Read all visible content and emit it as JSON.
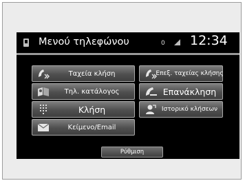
{
  "header": {
    "title": "Μενού τηλεφώνου",
    "status_text": "0",
    "clock": "12:34"
  },
  "menu": {
    "speed_dial": "Ταχεία κλήση",
    "edit_speed_dial": "Επεξ. ταχείας κλήσης",
    "phonebook": "Τηλ. κατάλογος",
    "redial": "Επανάκληση",
    "dial": "Κλήση",
    "call_history": "Ιστορικό κλήσεων",
    "text_email": "Κείμενο/Email"
  },
  "footer": {
    "settings_label": "Ρύθμιση"
  },
  "icons": {
    "speed_dial": "handset-arrows-icon",
    "edit_speed_dial": "handset-arrows-icon",
    "phonebook": "book-icon",
    "redial": "handset-icon",
    "dial": "keypad-icon",
    "call_history": "caller-icon",
    "text_email": "envelope-icon"
  },
  "colors": {
    "screen_background": "#000000",
    "tile_top": "#7d7d7d",
    "tile_bottom": "#3f3f3f",
    "text": "#ffffff"
  }
}
